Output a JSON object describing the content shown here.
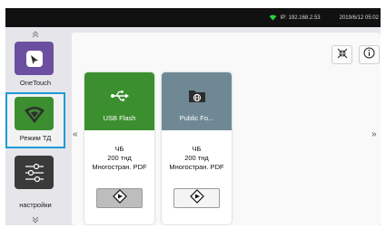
{
  "status_bar": {
    "ip": "IP: 192.168.2.53",
    "datetime": "2019/6/12 05:02",
    "wifi_color": "#2ecc40"
  },
  "sidebar": {
    "apps": [
      {
        "label": "OneTouch",
        "tile_color": "#6b4fa1",
        "icon": "onetouch-icon"
      },
      {
        "label": "Режим ТД",
        "tile_color": "#3c8f2f",
        "icon": "wifi-access-point-icon",
        "selected": true
      },
      {
        "label": "настройки",
        "tile_color": "#3a3a3a",
        "icon": "sliders-icon"
      }
    ]
  },
  "toolbar": {
    "collapse_icon": "collapse-arrows-icon",
    "info_icon": "info-icon"
  },
  "nav": {
    "prev": "«",
    "next": "»"
  },
  "cards": [
    {
      "title": "USB Flash",
      "header_color": "#3c8f2f",
      "icon": "usb-icon",
      "mode": "ЧБ",
      "resolution": "200 тнд",
      "format": "Многостран. PDF",
      "button_pressed": true
    },
    {
      "title": "Public Fo...",
      "header_color": "#6e8994",
      "icon": "network-folder-icon",
      "mode": "ЧБ",
      "resolution": "200 тнд",
      "format": "Многостран. PDF",
      "button_pressed": false
    }
  ]
}
